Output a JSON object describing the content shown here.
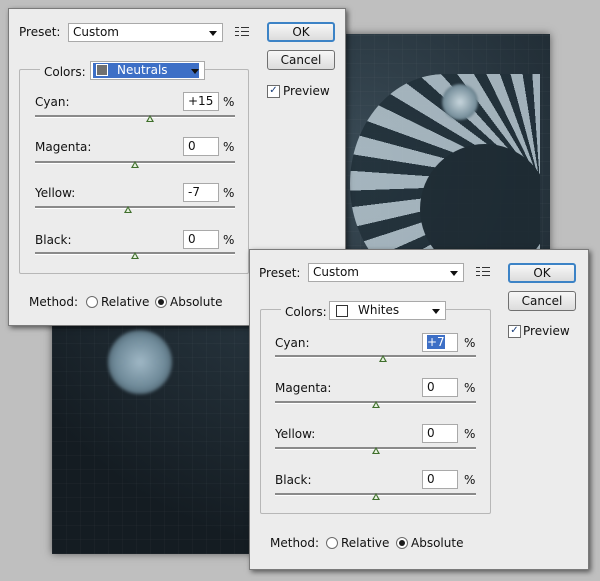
{
  "dialogs": [
    {
      "preset_label": "Preset:",
      "preset_value": "Custom",
      "ok_label": "OK",
      "cancel_label": "Cancel",
      "preview_label": "Preview",
      "preview_checked": true,
      "colors_label": "Colors:",
      "colors_value": "Neutrals",
      "colors_swatch": "#707070",
      "colors_highlighted": true,
      "sliders": [
        {
          "label": "Cyan:",
          "value": "+15",
          "pct": "%",
          "position": 0.575
        },
        {
          "label": "Magenta:",
          "value": "0",
          "pct": "%",
          "position": 0.5
        },
        {
          "label": "Yellow:",
          "value": "-7",
          "pct": "%",
          "position": 0.465
        },
        {
          "label": "Black:",
          "value": "0",
          "pct": "%",
          "position": 0.5
        }
      ],
      "method_label": "Method:",
      "method_options": [
        "Relative",
        "Absolute"
      ],
      "method_selected": "Absolute"
    },
    {
      "preset_label": "Preset:",
      "preset_value": "Custom",
      "ok_label": "OK",
      "cancel_label": "Cancel",
      "preview_label": "Preview",
      "preview_checked": true,
      "colors_label": "Colors:",
      "colors_value": "Whites",
      "colors_swatch": "#ffffff",
      "colors_highlighted": false,
      "sliders": [
        {
          "label": "Cyan:",
          "value": "+7",
          "pct": "%",
          "position": 0.535,
          "selected": true
        },
        {
          "label": "Magenta:",
          "value": "0",
          "pct": "%",
          "position": 0.5
        },
        {
          "label": "Yellow:",
          "value": "0",
          "pct": "%",
          "position": 0.5
        },
        {
          "label": "Black:",
          "value": "0",
          "pct": "%",
          "position": 0.5
        }
      ],
      "method_label": "Method:",
      "method_options": [
        "Relative",
        "Absolute"
      ],
      "method_selected": "Absolute"
    }
  ],
  "colors": {
    "highlight": "#3d6fc6",
    "slider_thumb": "#3f6e2c",
    "ok_border": "#3c83c6"
  },
  "icons": {
    "preset_menu": "list-menu-icon",
    "dropdown": "chevron-down-icon"
  }
}
